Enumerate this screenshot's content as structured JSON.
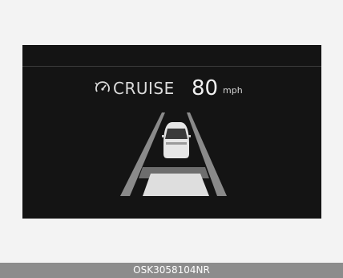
{
  "cluster_display": {
    "mode_label": "CRUISE",
    "set_speed": "80",
    "speed_unit": "mph",
    "mode_icon": "cruise-control-icon"
  },
  "footer": {
    "code": "OSK3058104NR"
  },
  "colors": {
    "background": "#f3f3f3",
    "display_background": "#141414",
    "text_primary": "#f0f0f0",
    "footer_bar": "#8c8c8c"
  }
}
